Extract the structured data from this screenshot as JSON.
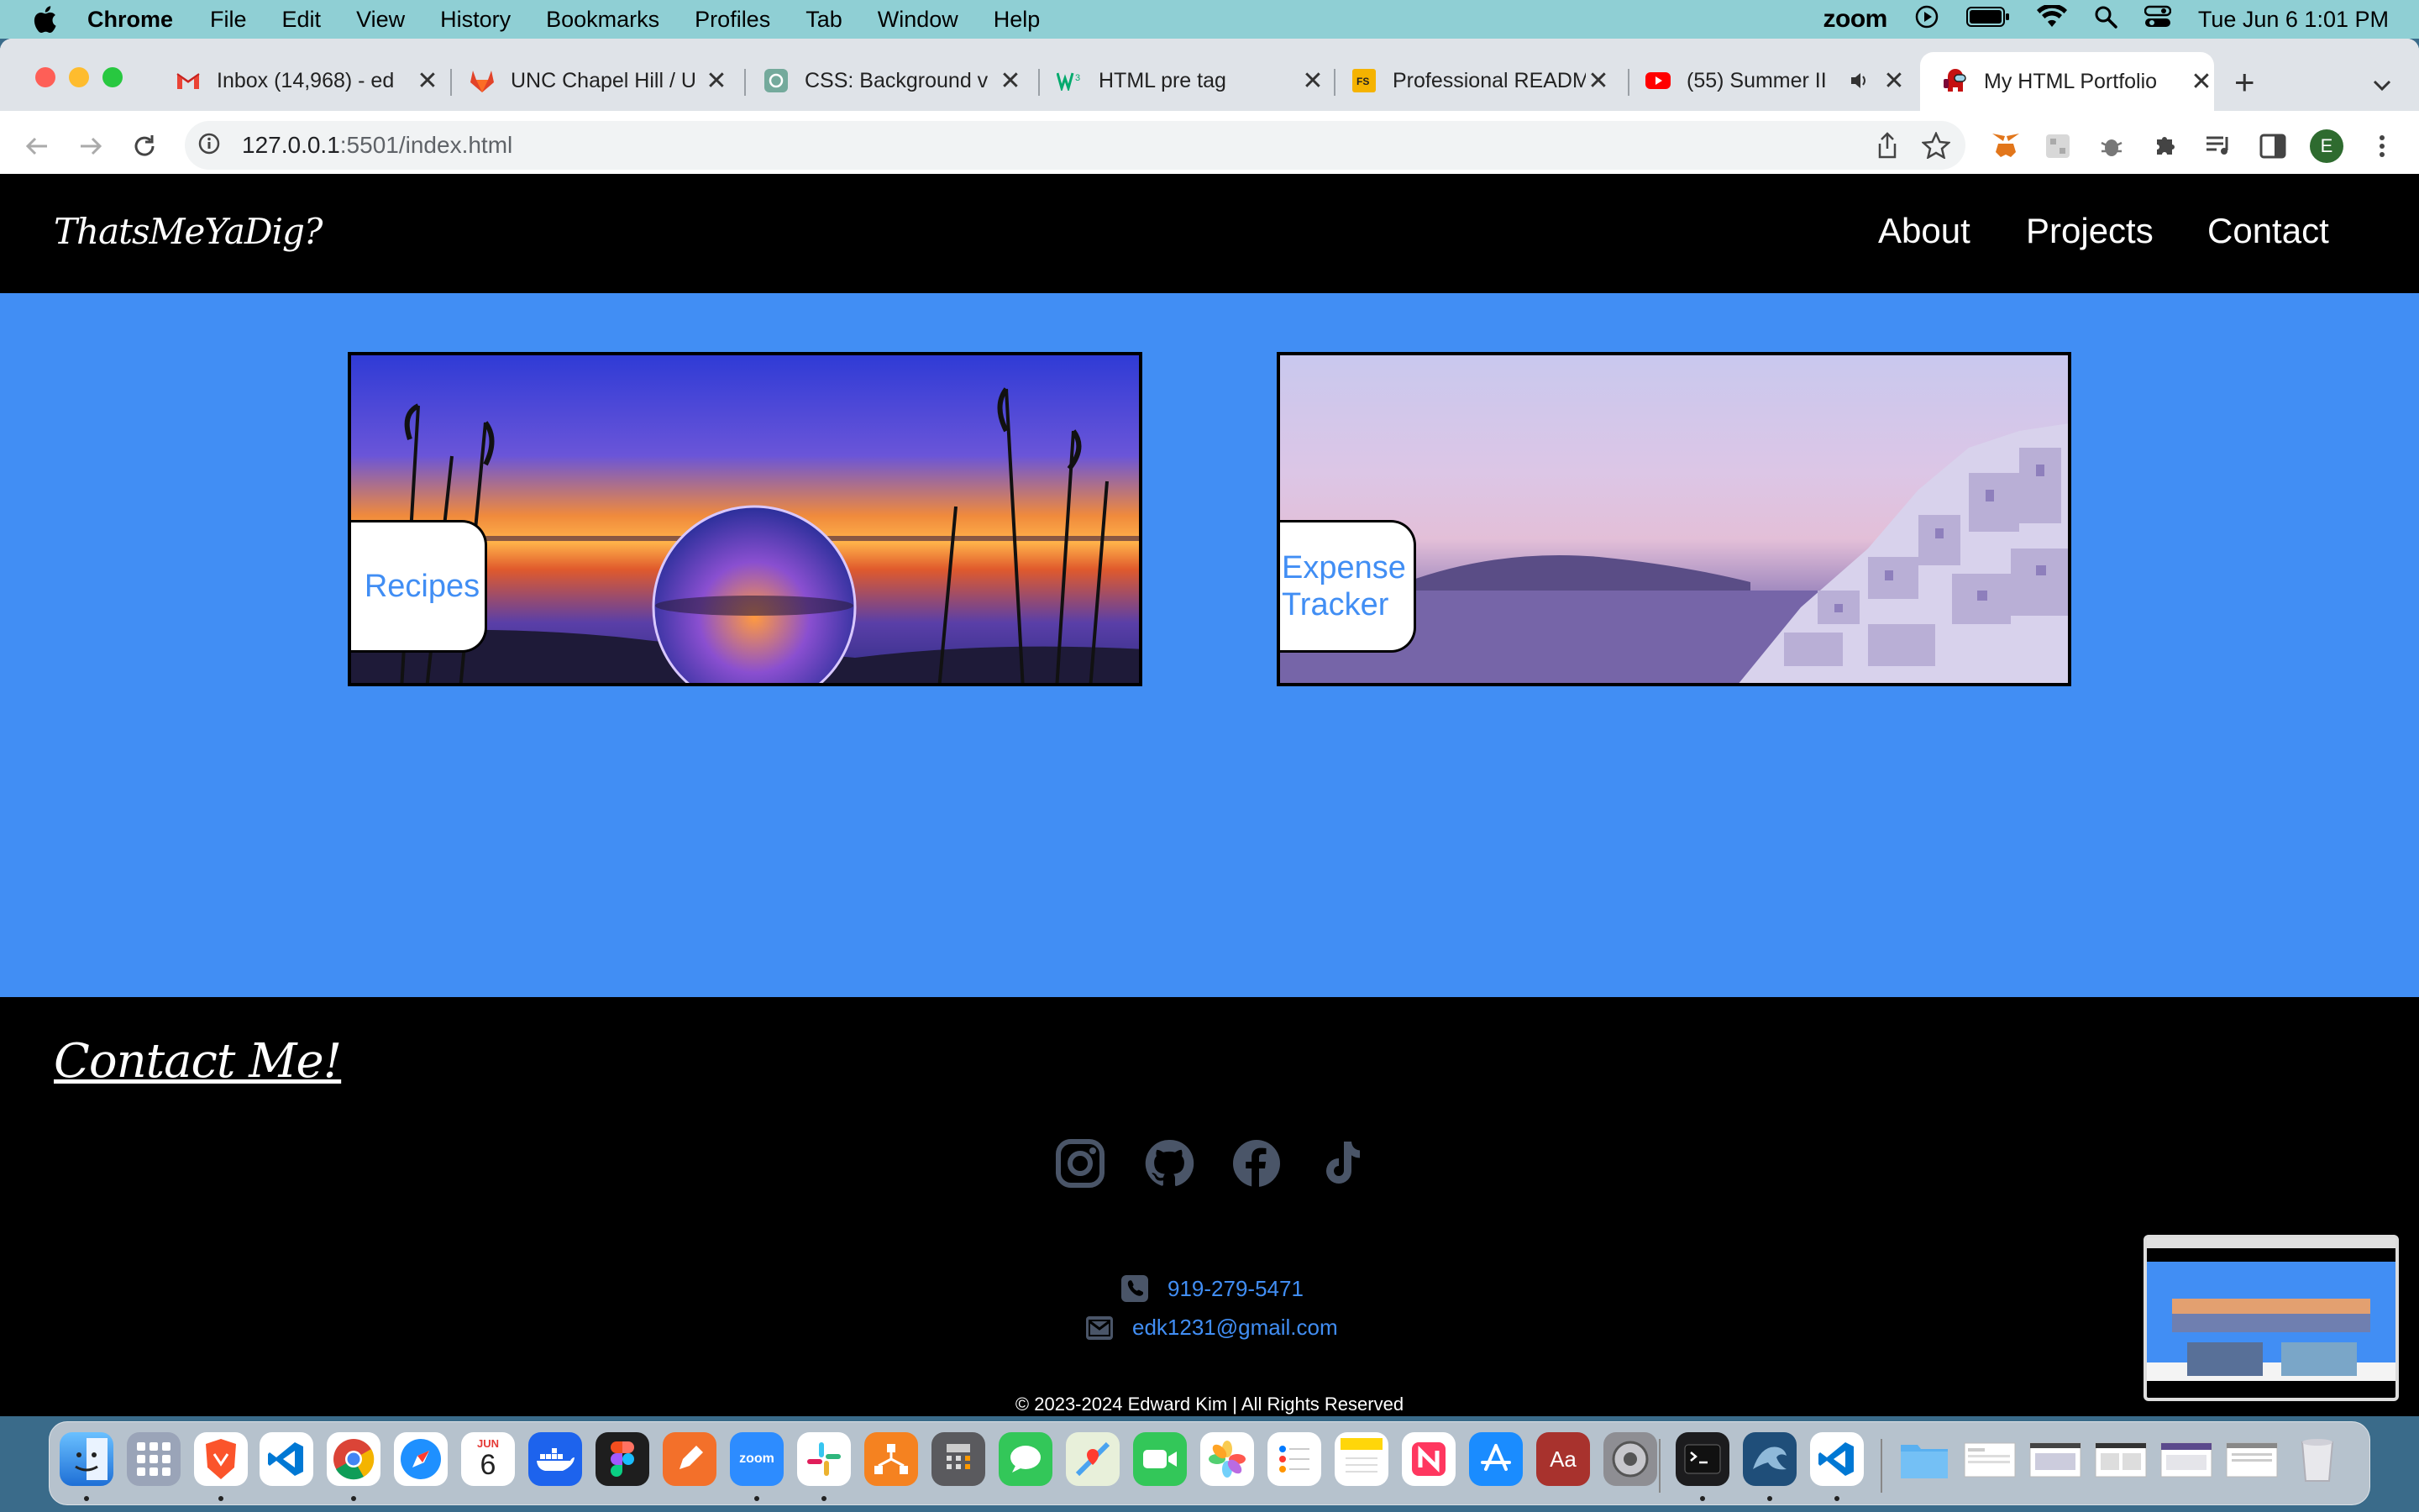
{
  "menubar": {
    "app": "Chrome",
    "items": [
      "File",
      "Edit",
      "View",
      "History",
      "Bookmarks",
      "Profiles",
      "Tab",
      "Window",
      "Help"
    ],
    "zoom": "zoom",
    "datetime": "Tue Jun 6  1:01 PM"
  },
  "tabs": [
    {
      "title": "Inbox (14,968) - ed",
      "icon": "gmail-icon"
    },
    {
      "title": "UNC Chapel Hill / U",
      "icon": "gitlab-icon"
    },
    {
      "title": "CSS: Background v",
      "icon": "chatgpt-icon"
    },
    {
      "title": "HTML pre tag",
      "icon": "w3schools-icon"
    },
    {
      "title": "Professional READM",
      "icon": "fs-icon"
    },
    {
      "title": "(55) Summer II",
      "icon": "youtube-icon"
    },
    {
      "title": "My HTML Portfolio",
      "icon": "amongus-icon"
    }
  ],
  "address": {
    "host": "127.0.0.1",
    "path": ":5501/index.html"
  },
  "profile_initial": "E",
  "site": {
    "logo": "ThatsMeYaDig?",
    "nav": [
      "About",
      "Projects",
      "Contact"
    ],
    "projects": [
      {
        "label_line1": "Recipes",
        "label_line2": ""
      },
      {
        "label_line1": "Expense",
        "label_line2": "Tracker"
      }
    ],
    "contact_title": "Contact Me!",
    "socials": [
      "instagram-icon",
      "github-icon",
      "facebook-icon",
      "tiktok-icon"
    ],
    "phone": "919-279-5471",
    "email": "edk1231@gmail.com",
    "copyright": "© 2023-2024 Edward Kim | All Rights Reserved"
  },
  "dock": {
    "calendar_month": "JUN",
    "calendar_day": "6",
    "zoom_label": "zoom",
    "dictionary_label": "Aa"
  },
  "colors": {
    "accent": "#418ef4",
    "nav_bg": "#000000",
    "menubar": "#8fcfd4"
  }
}
